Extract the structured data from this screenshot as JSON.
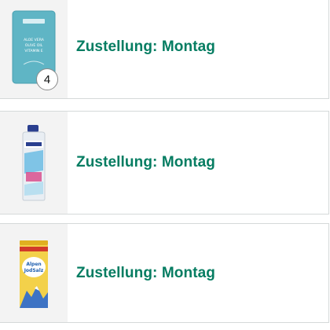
{
  "orders": [
    {
      "product_icon": "aloe-vera-sheet-mask-icon",
      "product_label": "ALOE VERA OLIVE OIL VITAMIN E",
      "quantity": "4",
      "delivery": "Zustellung: Montag"
    },
    {
      "product_icon": "laundry-detergent-bottle-icon",
      "quantity": null,
      "delivery": "Zustellung: Montag"
    },
    {
      "product_icon": "alpen-jodsalz-salt-shaker-icon",
      "product_label": "Alpen JodSalz",
      "quantity": null,
      "delivery": "Zustellung: Montag"
    }
  ],
  "colors": {
    "delivery_text": "#067d62",
    "thumb_bg": "#f3f3f3",
    "card_border": "#d5d9d9"
  }
}
